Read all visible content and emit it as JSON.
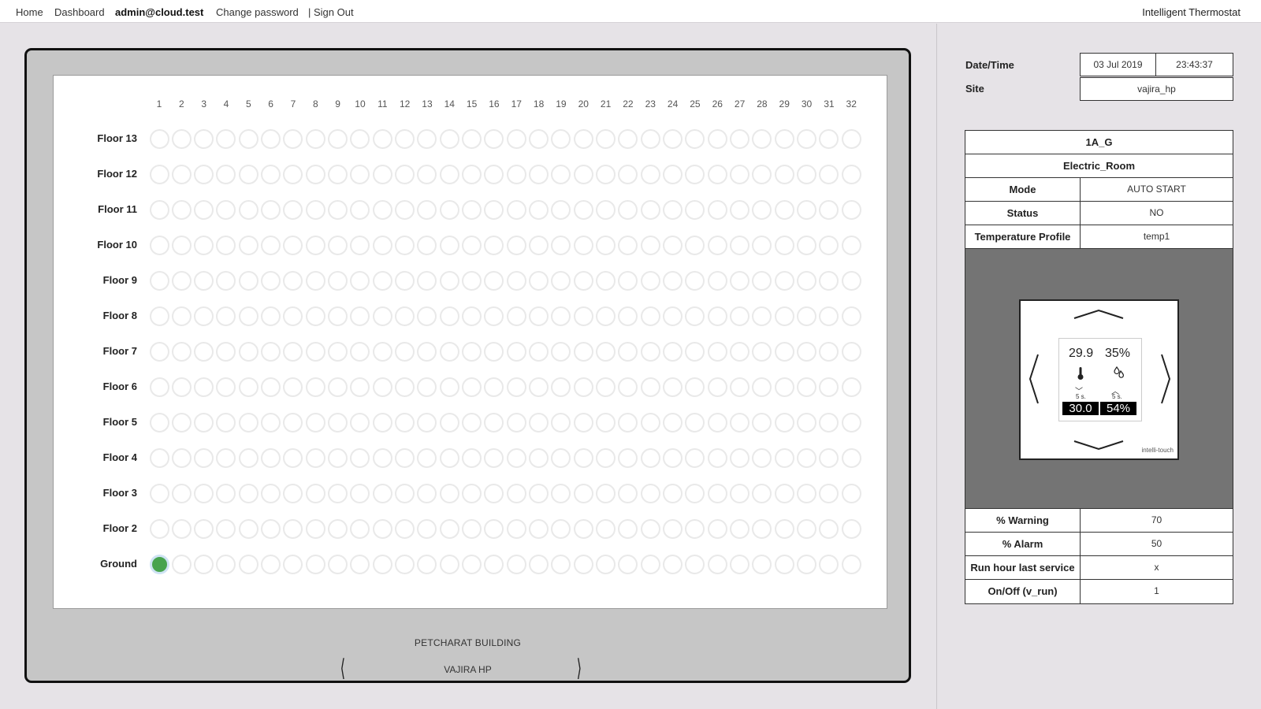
{
  "nav": {
    "home": "Home",
    "dashboard": "Dashboard",
    "user": "admin@cloud.test",
    "change_password": "Change password",
    "sign_out": "| Sign Out",
    "app_title": "Intelligent Thermostat"
  },
  "building": {
    "columns": [
      "1",
      "2",
      "3",
      "4",
      "5",
      "6",
      "7",
      "8",
      "9",
      "10",
      "11",
      "12",
      "13",
      "14",
      "15",
      "16",
      "17",
      "18",
      "19",
      "20",
      "21",
      "22",
      "23",
      "24",
      "25",
      "26",
      "27",
      "28",
      "29",
      "30",
      "31",
      "32"
    ],
    "floors": [
      "Floor 13",
      "Floor 12",
      "Floor 11",
      "Floor 10",
      "Floor 9",
      "Floor 8",
      "Floor 7",
      "Floor 6",
      "Floor 5",
      "Floor 4",
      "Floor 3",
      "Floor 2",
      "Ground"
    ],
    "active_units": [
      {
        "floor": "Ground",
        "column": "1",
        "color": "#47a34e"
      }
    ],
    "building_name": "PETCHARAT BUILDING",
    "site_name": "VAJIRA HP",
    "prev_icon": "chevron-left-icon",
    "next_icon": "chevron-right-icon"
  },
  "header_info": {
    "datetime_label": "Date/Time",
    "date": "03 Jul 2019",
    "time": "23:43:37",
    "site_label": "Site",
    "site": "vajira_hp"
  },
  "device_info": {
    "unit_id": "1A_G",
    "room": "Electric_Room",
    "mode_label": "Mode",
    "mode": "AUTO START",
    "status_label": "Status",
    "status": "NO",
    "profile_label": "Temperature Profile",
    "profile": "temp1",
    "warning_label": "% Warning",
    "warning": "70",
    "alarm_label": "% Alarm",
    "alarm": "50",
    "run_hour_label": "Run hour last service",
    "run_hour": "x",
    "onoff_label": "On/Off (v_run)",
    "onoff": "1"
  },
  "thermostat": {
    "temperature": "29.9",
    "humidity": "35%",
    "temp_icon": "thermometer-icon",
    "humidity_icon": "droplets-icon",
    "temp_timer": "5 s.",
    "humidity_timer": "5 s.",
    "temp_setpoint": "30.0",
    "humidity_setpoint": "54%",
    "brand": "intelli-touch"
  }
}
